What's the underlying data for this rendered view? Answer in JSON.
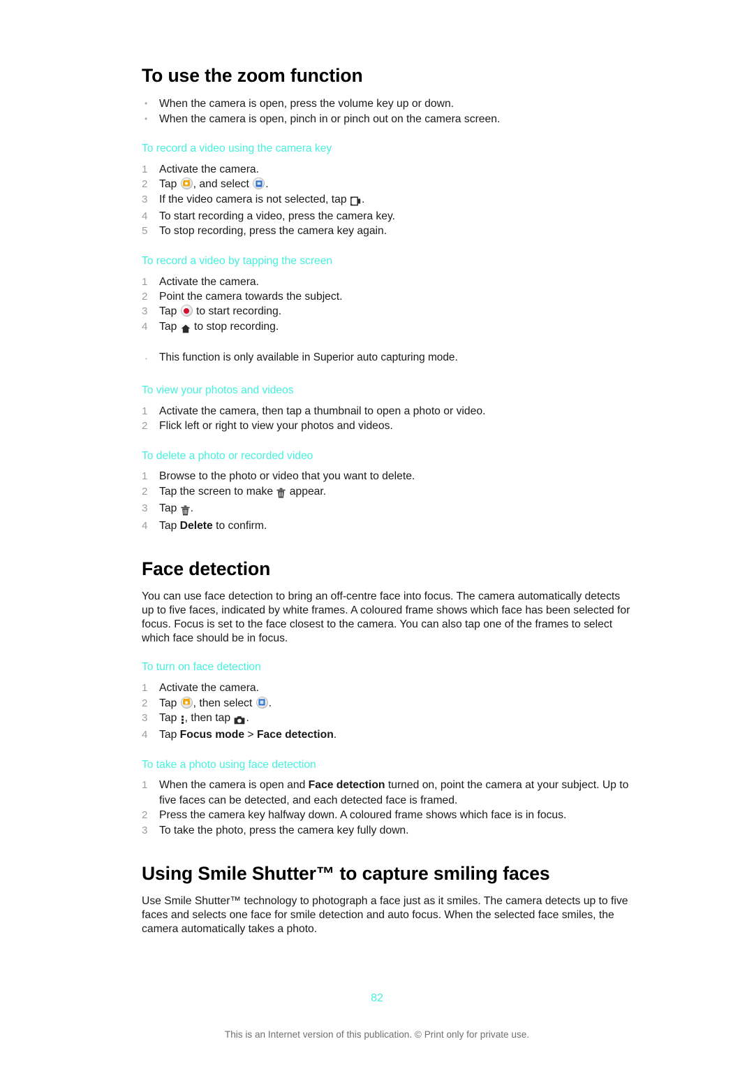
{
  "document": {
    "page_number": "82",
    "footer_note": "This is an Internet version of this publication. © Print only for private use.",
    "accent_color": "#44F2DD",
    "text_color": "#1a1a1a",
    "marker_color": "#9d9d9d"
  },
  "sections": [
    {
      "id": "zoom-function",
      "heading": "To use the zoom function",
      "heading_level": "task",
      "bullets": [
        "When the camera is open, press the volume key up or down.",
        "When the camera is open, pinch in or pinch out on the camera screen."
      ]
    },
    {
      "id": "record-video-camera-key",
      "heading": "To record a video using the camera key",
      "steps": [
        {
          "n": "1",
          "text": "Activate the camera."
        },
        {
          "n": "2",
          "pre": "Tap ",
          "icon1": "camera-mode-icon",
          "mid": ", and select ",
          "icon2": "video-mode-icon",
          "post": "."
        },
        {
          "n": "3",
          "pre": "If the video camera is not selected, tap ",
          "icon1": "video-camera-icon",
          "post": "."
        },
        {
          "n": "4",
          "text": "To start recording a video, press the camera key."
        },
        {
          "n": "5",
          "text": "To stop recording, press the camera key again."
        }
      ]
    },
    {
      "id": "record-video-tapping",
      "heading": "To record a video by tapping the screen",
      "steps": [
        {
          "n": "1",
          "text": "Activate the camera."
        },
        {
          "n": "2",
          "text": "Point the camera towards the subject."
        },
        {
          "n": "3",
          "pre": "Tap ",
          "icon1": "record-icon",
          "post": " to start recording."
        },
        {
          "n": "4",
          "pre": "Tap ",
          "icon1": "stop-recording-icon",
          "post": " to stop recording."
        }
      ],
      "note": "This function is only available in Superior auto capturing mode."
    },
    {
      "id": "view-photos-videos",
      "heading": "To view your photos and videos",
      "steps": [
        {
          "n": "1",
          "text": "Activate the camera, then tap a thumbnail to open a photo or video."
        },
        {
          "n": "2",
          "text": "Flick left or right to view your photos and videos."
        }
      ]
    },
    {
      "id": "delete-photo-video",
      "heading": "To delete a photo or recorded video",
      "steps": [
        {
          "n": "1",
          "text": "Browse to the photo or video that you want to delete."
        },
        {
          "n": "2",
          "pre": "Tap the screen to make ",
          "icon1": "trash-icon",
          "post": " appear."
        },
        {
          "n": "3",
          "pre": "Tap ",
          "icon1": "trash-icon",
          "post": "."
        },
        {
          "n": "4",
          "pre": "Tap ",
          "bold1": "Delete",
          "post": " to confirm."
        }
      ]
    },
    {
      "id": "face-detection",
      "heading": "Face detection",
      "heading_level": "chapter",
      "paragraph": "You can use face detection to bring an off-centre face into focus. The camera automatically detects up to five faces, indicated by white frames. A coloured frame shows which face has been selected for focus. Focus is set to the face closest to the camera. You can also tap one of the frames to select which face should be in focus."
    },
    {
      "id": "turn-on-face-detection",
      "heading": "To turn on face detection",
      "steps": [
        {
          "n": "1",
          "text": "Activate the camera."
        },
        {
          "n": "2",
          "pre": "Tap ",
          "icon1": "camera-mode-icon",
          "mid": ", then select ",
          "icon2": "video-mode-icon",
          "post": "."
        },
        {
          "n": "3",
          "pre": "Tap ",
          "icon1": "more-options-icon",
          "mid": ", then tap ",
          "icon2": "camera-settings-icon",
          "post": "."
        },
        {
          "n": "4",
          "pre": "Tap ",
          "bold1": "Focus mode",
          "mid": " > ",
          "bold2": "Face detection",
          "post": "."
        }
      ]
    },
    {
      "id": "take-photo-face-detection",
      "heading": "To take a photo using face detection",
      "steps": [
        {
          "n": "1",
          "pre": "When the camera is open and ",
          "bold1": "Face detection",
          "post": " turned on, point the camera at your subject. Up to five faces can be detected, and each detected face is framed."
        },
        {
          "n": "2",
          "text": "Press the camera key halfway down. A coloured frame shows which face is in focus."
        },
        {
          "n": "3",
          "text": "To take the photo, press the camera key fully down."
        }
      ]
    },
    {
      "id": "smile-shutter",
      "heading": "Using Smile Shutter™ to capture smiling faces",
      "heading_level": "chapter",
      "paragraph": "Use Smile Shutter™ technology to photograph a face just as it smiles. The camera detects up to five faces and selects one face for smile detection and auto focus. When the selected face smiles, the camera automatically takes a photo."
    }
  ]
}
